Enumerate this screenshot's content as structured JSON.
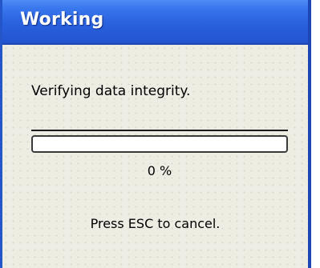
{
  "window": {
    "title": "Working",
    "title_color": "#ffffff",
    "titlebar_color": "#2a63df",
    "background_color": "#eeede4"
  },
  "status": {
    "message": "Verifying data integrity."
  },
  "progress": {
    "percent_label": "0 %",
    "fraction": 0
  },
  "footer": {
    "hint": "Press ESC to cancel."
  }
}
